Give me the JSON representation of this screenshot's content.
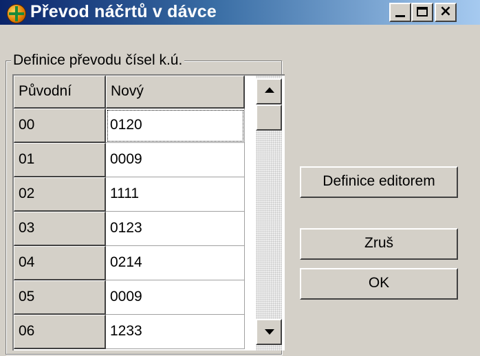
{
  "window": {
    "title": "Převod náčrtů v dávce",
    "title_bar_colors": [
      "#0a246a",
      "#a6caf0"
    ],
    "icon": "app-globe-icon",
    "controls": {
      "minimize": "minimize-icon",
      "maximize": "maximize-icon",
      "close": "×"
    }
  },
  "group": {
    "legend": "Definice převodu čísel k.ú."
  },
  "table": {
    "headers": [
      "Původní",
      "Nový"
    ],
    "rows": [
      {
        "original": "00",
        "new": "0120"
      },
      {
        "original": "01",
        "new": "0009"
      },
      {
        "original": "02",
        "new": "1111"
      },
      {
        "original": "03",
        "new": "0123"
      },
      {
        "original": "04",
        "new": "0214"
      },
      {
        "original": "05",
        "new": "0009"
      },
      {
        "original": "06",
        "new": "1233"
      }
    ],
    "focused_row": 0
  },
  "buttons": {
    "editor": "Definice editorem",
    "cancel": "Zruš",
    "ok": "OK"
  }
}
